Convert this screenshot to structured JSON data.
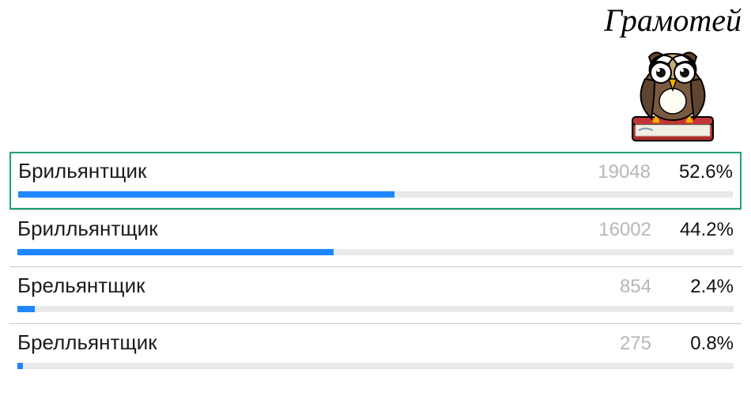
{
  "brand": {
    "title": "Грамотей"
  },
  "chart_data": {
    "type": "bar",
    "title": "",
    "xlabel": "",
    "ylabel": "",
    "categories": [
      "Брильянтщик",
      "Брилльянтщик",
      "Брельянтщик",
      "Брелльянтщик"
    ],
    "values": [
      52.6,
      44.2,
      2.4,
      0.8
    ],
    "counts": [
      19048,
      16002,
      854,
      275
    ],
    "ylim": [
      0,
      100
    ]
  },
  "options": [
    {
      "label": "Брильянтщик",
      "count": "19048",
      "pct": "52.6%",
      "pct_num": 52.6,
      "correct": true
    },
    {
      "label": "Брилльянтщик",
      "count": "16002",
      "pct": "44.2%",
      "pct_num": 44.2,
      "correct": false
    },
    {
      "label": "Брельянтщик",
      "count": "854",
      "pct": "2.4%",
      "pct_num": 2.4,
      "correct": false
    },
    {
      "label": "Брелльянтщик",
      "count": "275",
      "pct": "0.8%",
      "pct_num": 0.8,
      "correct": false
    }
  ]
}
